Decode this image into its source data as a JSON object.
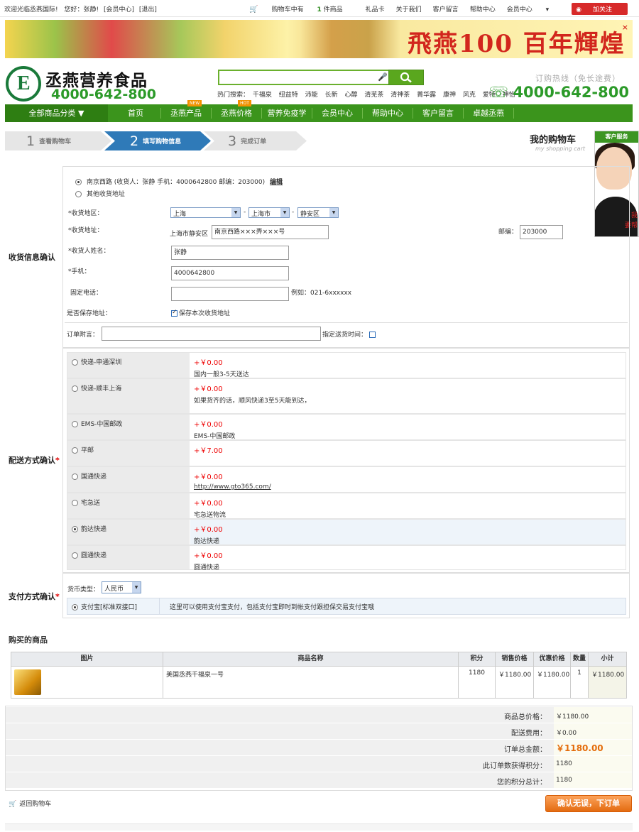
{
  "topbar": {
    "welcome": "欢迎光临丞燕国际!",
    "greeting": "您好：张静!",
    "member": "[会员中心]",
    "logout": "[退出]",
    "cart_prefix": "购物车中有",
    "cart_count": "1",
    "cart_suffix": "件商品",
    "links": [
      "礼品卡",
      "关于我们",
      "客户留言",
      "帮助中心",
      "会员中心"
    ],
    "follow": "加关注"
  },
  "banner": {
    "slogan": "飛燕100 百年輝煌",
    "close": "×"
  },
  "header": {
    "brand": "丞燕营养食品",
    "tel": "4000-642-800",
    "hot_label": "热门搜索：",
    "hot_words": [
      "千福泉",
      "纽益特",
      "沛能",
      "长新",
      "心醇",
      "清芜茶",
      "清神茶",
      "菁华露",
      "康神",
      "风克",
      "爱特",
      "神怡"
    ],
    "hotline_label": "订购热线（免长途费）",
    "hotline_number": "4000-642-800"
  },
  "nav": {
    "category": "全部商品分类 ▼",
    "items": [
      {
        "label": "首页",
        "badge": ""
      },
      {
        "label": "丞燕产品",
        "badge": "NEW"
      },
      {
        "label": "丞燕价格",
        "badge": "HOT"
      },
      {
        "label": "营养免疫学",
        "badge": ""
      },
      {
        "label": "会员中心",
        "badge": ""
      },
      {
        "label": "帮助中心",
        "badge": ""
      },
      {
        "label": "客户留言",
        "badge": ""
      },
      {
        "label": "卓越丞燕",
        "badge": ""
      }
    ]
  },
  "steps": [
    {
      "num": "1",
      "label": "查看购物车"
    },
    {
      "num": "2",
      "label": "填写购物信息"
    },
    {
      "num": "3",
      "label": "完成订单"
    }
  ],
  "mycart": {
    "title": "我的购物车",
    "subtitle": "my shopping cart"
  },
  "service": {
    "title": "客户服务",
    "text1": "我",
    "text2": "要帮"
  },
  "address": {
    "section": "收货信息确认",
    "saved": "南京西路 (收货人：张静 手机：4000642800 邮编：203000)",
    "edit": "编辑",
    "other": "其他收货地址",
    "region_label": "*收货地区：",
    "province": "上海",
    "city": "上海市",
    "district": "静安区",
    "addr_label": "*收货地址：",
    "addr_prefix": "上海市静安区",
    "addr_value": "南京西路×××弄×××号",
    "zip_label": "邮编：",
    "zip_value": "203000",
    "name_label": "*收货人姓名：",
    "name_value": "张静",
    "mobile_label": "*手机：",
    "mobile_value": "4000642800",
    "phone_label": "固定电话：",
    "phone_value": "",
    "phone_example": "例如：021-6xxxxxx",
    "save_label": "是否保存地址：",
    "save_text": "保存本次收货地址",
    "note_label": "订单附言：",
    "note_value": "",
    "time_label": "指定送货时间："
  },
  "shipping": {
    "section": "配送方式确认",
    "methods": [
      {
        "name": "快递-申通深圳",
        "price": "+￥0.00",
        "desc": "国内一般3-5天送达"
      },
      {
        "name": "快递-顺丰上海",
        "price": "+￥0.00",
        "desc": "如果货齐的话，顺风快递3至5天能到达，"
      },
      {
        "name": "EMS-中国邮政",
        "price": "+￥0.00",
        "desc": "EMS-中国邮政"
      },
      {
        "name": "平邮",
        "price": "+￥7.00",
        "desc": ""
      },
      {
        "name": "国通快递",
        "price": "+￥0.00",
        "desc": "http://www.gto365.com/"
      },
      {
        "name": "宅急送",
        "price": "+￥0.00",
        "desc": "宅急送物流"
      },
      {
        "name": "韵达快递",
        "price": "+￥0.00",
        "desc": "韵达快递"
      },
      {
        "name": "圆通快递",
        "price": "+￥0.00",
        "desc": "圆通快递"
      }
    ],
    "selected": 6
  },
  "payment": {
    "section": "支付方式确认",
    "currency_label": "货币类型：",
    "currency": "人民币",
    "method": "支付宝[标准双接口]",
    "method_desc": "这里可以使用支付宝支付，包括支付宝即时到帐支付跟担保交易支付宝哦"
  },
  "goods": {
    "title": "购买的商品",
    "headers": [
      "图片",
      "商品名称",
      "积分",
      "销售价格",
      "优惠价格",
      "数量",
      "小计"
    ],
    "rows": [
      {
        "name": "美国丞燕千福泉一号",
        "points": "1180",
        "price": "￥1180.00",
        "discount": "￥1180.00",
        "qty": "1",
        "subtotal": "￥1180.00"
      }
    ]
  },
  "summary": {
    "rows": [
      {
        "label": "商品总价格：",
        "value": "￥1180.00"
      },
      {
        "label": "配送费用：",
        "value": "￥0.00"
      },
      {
        "label": "订单总金额：",
        "value": "￥1180.00"
      },
      {
        "label": "此订单数获得积分：",
        "value": "1180"
      },
      {
        "label": "您的积分总计：",
        "value": "1180"
      }
    ]
  },
  "footer": {
    "back": "返回购物车",
    "confirm": "确认无误，下订单"
  }
}
